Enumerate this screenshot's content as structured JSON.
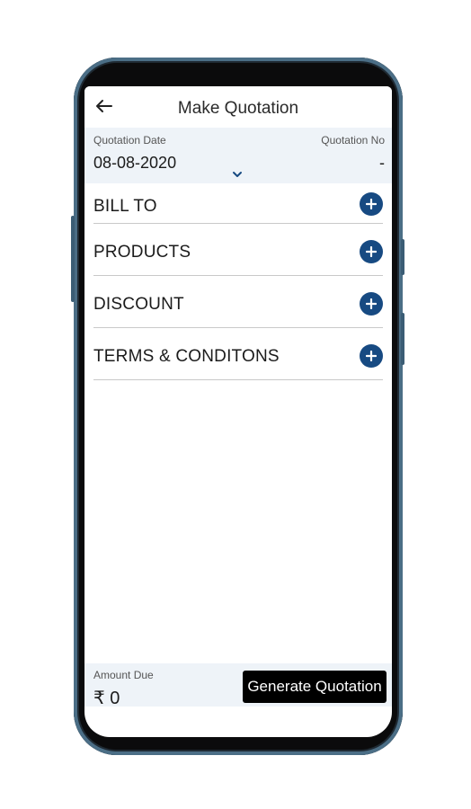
{
  "header": {
    "title": "Make Quotation",
    "back_icon": "arrow-left-icon"
  },
  "quotation": {
    "date_label": "Quotation Date",
    "date_value": "08-08-2020",
    "dropdown_icon": "chevron-down-icon",
    "number_label": "Quotation No",
    "number_value": "-"
  },
  "sections": [
    {
      "label": "BILL TO",
      "icon": "plus-circle-icon"
    },
    {
      "label": "PRODUCTS",
      "icon": "plus-circle-icon"
    },
    {
      "label": "DISCOUNT",
      "icon": "plus-circle-icon"
    },
    {
      "label": "TERMS & CONDITONS",
      "icon": "plus-circle-icon"
    }
  ],
  "footer": {
    "amount_label": "Amount Due",
    "amount_value": "₹ 0",
    "generate_label": "Generate Quotation"
  },
  "colors": {
    "accent": "#174a82",
    "panel_bg": "#eef3f8",
    "button_bg": "#000000",
    "frame_border": "#4b6e86"
  }
}
